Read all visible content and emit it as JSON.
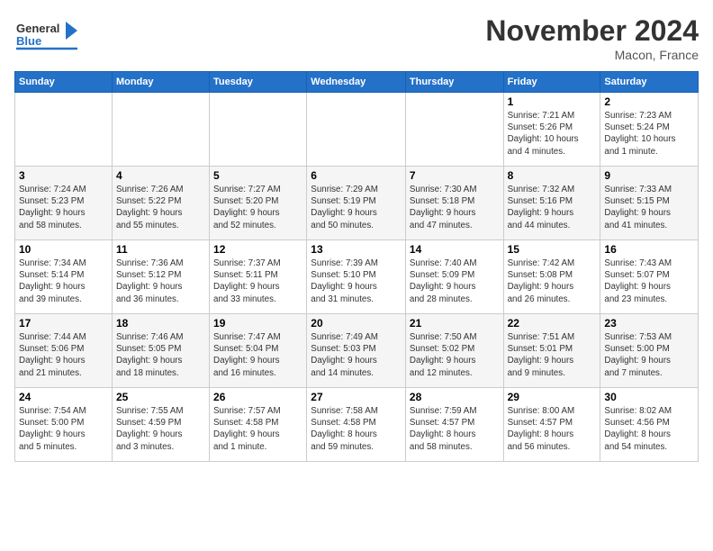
{
  "header": {
    "logo_general": "General",
    "logo_blue": "Blue",
    "title": "November 2024",
    "subtitle": "Macon, France"
  },
  "calendar": {
    "weekdays": [
      "Sunday",
      "Monday",
      "Tuesday",
      "Wednesday",
      "Thursday",
      "Friday",
      "Saturday"
    ],
    "weeks": [
      [
        {
          "day": "",
          "info": ""
        },
        {
          "day": "",
          "info": ""
        },
        {
          "day": "",
          "info": ""
        },
        {
          "day": "",
          "info": ""
        },
        {
          "day": "",
          "info": ""
        },
        {
          "day": "1",
          "info": "Sunrise: 7:21 AM\nSunset: 5:26 PM\nDaylight: 10 hours\nand 4 minutes."
        },
        {
          "day": "2",
          "info": "Sunrise: 7:23 AM\nSunset: 5:24 PM\nDaylight: 10 hours\nand 1 minute."
        }
      ],
      [
        {
          "day": "3",
          "info": "Sunrise: 7:24 AM\nSunset: 5:23 PM\nDaylight: 9 hours\nand 58 minutes."
        },
        {
          "day": "4",
          "info": "Sunrise: 7:26 AM\nSunset: 5:22 PM\nDaylight: 9 hours\nand 55 minutes."
        },
        {
          "day": "5",
          "info": "Sunrise: 7:27 AM\nSunset: 5:20 PM\nDaylight: 9 hours\nand 52 minutes."
        },
        {
          "day": "6",
          "info": "Sunrise: 7:29 AM\nSunset: 5:19 PM\nDaylight: 9 hours\nand 50 minutes."
        },
        {
          "day": "7",
          "info": "Sunrise: 7:30 AM\nSunset: 5:18 PM\nDaylight: 9 hours\nand 47 minutes."
        },
        {
          "day": "8",
          "info": "Sunrise: 7:32 AM\nSunset: 5:16 PM\nDaylight: 9 hours\nand 44 minutes."
        },
        {
          "day": "9",
          "info": "Sunrise: 7:33 AM\nSunset: 5:15 PM\nDaylight: 9 hours\nand 41 minutes."
        }
      ],
      [
        {
          "day": "10",
          "info": "Sunrise: 7:34 AM\nSunset: 5:14 PM\nDaylight: 9 hours\nand 39 minutes."
        },
        {
          "day": "11",
          "info": "Sunrise: 7:36 AM\nSunset: 5:12 PM\nDaylight: 9 hours\nand 36 minutes."
        },
        {
          "day": "12",
          "info": "Sunrise: 7:37 AM\nSunset: 5:11 PM\nDaylight: 9 hours\nand 33 minutes."
        },
        {
          "day": "13",
          "info": "Sunrise: 7:39 AM\nSunset: 5:10 PM\nDaylight: 9 hours\nand 31 minutes."
        },
        {
          "day": "14",
          "info": "Sunrise: 7:40 AM\nSunset: 5:09 PM\nDaylight: 9 hours\nand 28 minutes."
        },
        {
          "day": "15",
          "info": "Sunrise: 7:42 AM\nSunset: 5:08 PM\nDaylight: 9 hours\nand 26 minutes."
        },
        {
          "day": "16",
          "info": "Sunrise: 7:43 AM\nSunset: 5:07 PM\nDaylight: 9 hours\nand 23 minutes."
        }
      ],
      [
        {
          "day": "17",
          "info": "Sunrise: 7:44 AM\nSunset: 5:06 PM\nDaylight: 9 hours\nand 21 minutes."
        },
        {
          "day": "18",
          "info": "Sunrise: 7:46 AM\nSunset: 5:05 PM\nDaylight: 9 hours\nand 18 minutes."
        },
        {
          "day": "19",
          "info": "Sunrise: 7:47 AM\nSunset: 5:04 PM\nDaylight: 9 hours\nand 16 minutes."
        },
        {
          "day": "20",
          "info": "Sunrise: 7:49 AM\nSunset: 5:03 PM\nDaylight: 9 hours\nand 14 minutes."
        },
        {
          "day": "21",
          "info": "Sunrise: 7:50 AM\nSunset: 5:02 PM\nDaylight: 9 hours\nand 12 minutes."
        },
        {
          "day": "22",
          "info": "Sunrise: 7:51 AM\nSunset: 5:01 PM\nDaylight: 9 hours\nand 9 minutes."
        },
        {
          "day": "23",
          "info": "Sunrise: 7:53 AM\nSunset: 5:00 PM\nDaylight: 9 hours\nand 7 minutes."
        }
      ],
      [
        {
          "day": "24",
          "info": "Sunrise: 7:54 AM\nSunset: 5:00 PM\nDaylight: 9 hours\nand 5 minutes."
        },
        {
          "day": "25",
          "info": "Sunrise: 7:55 AM\nSunset: 4:59 PM\nDaylight: 9 hours\nand 3 minutes."
        },
        {
          "day": "26",
          "info": "Sunrise: 7:57 AM\nSunset: 4:58 PM\nDaylight: 9 hours\nand 1 minute."
        },
        {
          "day": "27",
          "info": "Sunrise: 7:58 AM\nSunset: 4:58 PM\nDaylight: 8 hours\nand 59 minutes."
        },
        {
          "day": "28",
          "info": "Sunrise: 7:59 AM\nSunset: 4:57 PM\nDaylight: 8 hours\nand 58 minutes."
        },
        {
          "day": "29",
          "info": "Sunrise: 8:00 AM\nSunset: 4:57 PM\nDaylight: 8 hours\nand 56 minutes."
        },
        {
          "day": "30",
          "info": "Sunrise: 8:02 AM\nSunset: 4:56 PM\nDaylight: 8 hours\nand 54 minutes."
        }
      ]
    ]
  }
}
